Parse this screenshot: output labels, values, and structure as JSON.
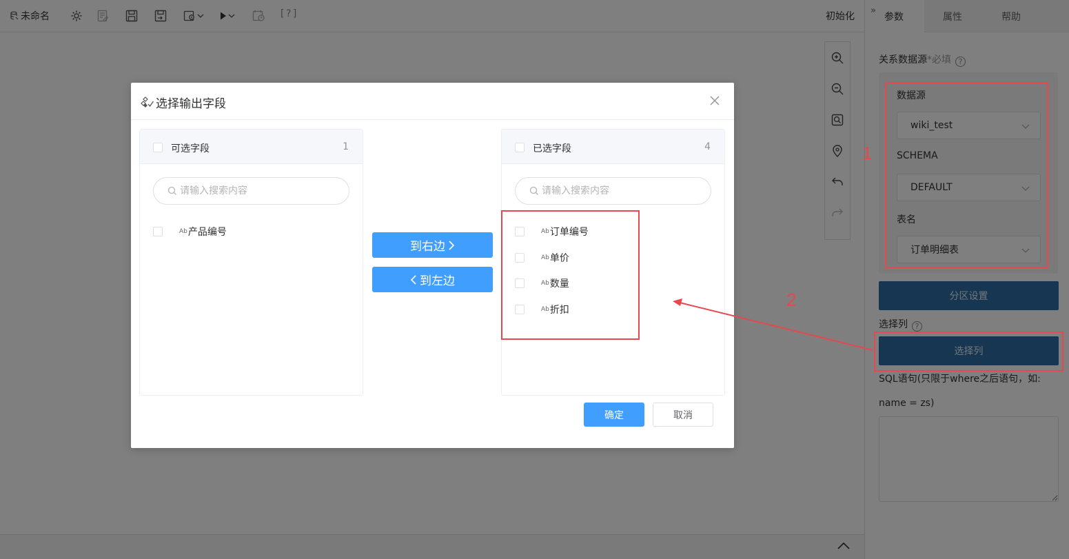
{
  "toolbar": {
    "title": "未命名",
    "init_label": "初始化",
    "help_bracket": "[?]"
  },
  "right_panel": {
    "tabs": [
      {
        "label": "参数",
        "active": true
      },
      {
        "label": "属性",
        "active": false
      },
      {
        "label": "帮助",
        "active": false
      }
    ],
    "datasource_label": "关系数据源",
    "required_text": "*必填",
    "datasource": {
      "label": "数据源",
      "value": "wiki_test"
    },
    "schema": {
      "label": "SCHEMA",
      "value": "DEFAULT"
    },
    "table": {
      "label": "表名",
      "value": "订单明细表"
    },
    "partition_button": "分区设置",
    "select_columns_label": "选择列",
    "select_columns_button": "选择列",
    "sql_label_line1": "SQL语句(只限于where之后语句，如:",
    "sql_label_line2": "name = zs)",
    "sql_value": ""
  },
  "dialog": {
    "title": "选择输出字段",
    "left_panel": {
      "title": "可选字段",
      "count": "1",
      "search_placeholder": "请输入搜索内容",
      "items": [
        "产品编号"
      ]
    },
    "right_panel": {
      "title": "已选字段",
      "count": "4",
      "search_placeholder": "请输入搜索内容",
      "items": [
        "订单编号",
        "单价",
        "数量",
        "折扣"
      ]
    },
    "to_right_label": "到右边",
    "to_left_label": "到左边",
    "ok_label": "确定",
    "cancel_label": "取消",
    "type_badge": "Ab"
  },
  "annotations": {
    "one": "1",
    "two": "2"
  },
  "colors": {
    "primary": "#409eff",
    "panel_button": "#2e6da4",
    "annotation": "#e5484d"
  }
}
